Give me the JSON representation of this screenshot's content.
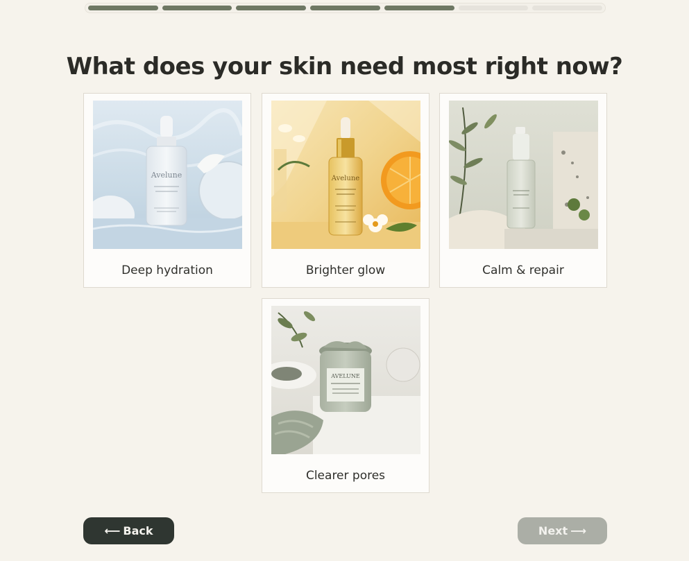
{
  "progress": {
    "total_steps": 7,
    "completed_steps": 5
  },
  "question": "What does your skin need most right now?",
  "options": [
    {
      "label": "Deep hydration",
      "image": "serum-bottle-water-photo",
      "brand": "Avelune"
    },
    {
      "label": "Brighter glow",
      "image": "vitamin-c-serum-orange-photo",
      "brand": "Avelune"
    },
    {
      "label": "Calm & repair",
      "image": "pump-bottle-olive-stone-photo",
      "brand": ""
    },
    {
      "label": "Clearer pores",
      "image": "clay-mask-jar-photo",
      "brand": "AVELUNE"
    }
  ],
  "nav": {
    "back_label": "Back",
    "next_label": "Next",
    "back_arrow": "⟵",
    "next_arrow": "⟶"
  },
  "colors": {
    "background": "#f6f3ec",
    "accent_dark": "#2f3631",
    "progress_done": "#6e7864",
    "next_disabled": "#abaea6"
  }
}
